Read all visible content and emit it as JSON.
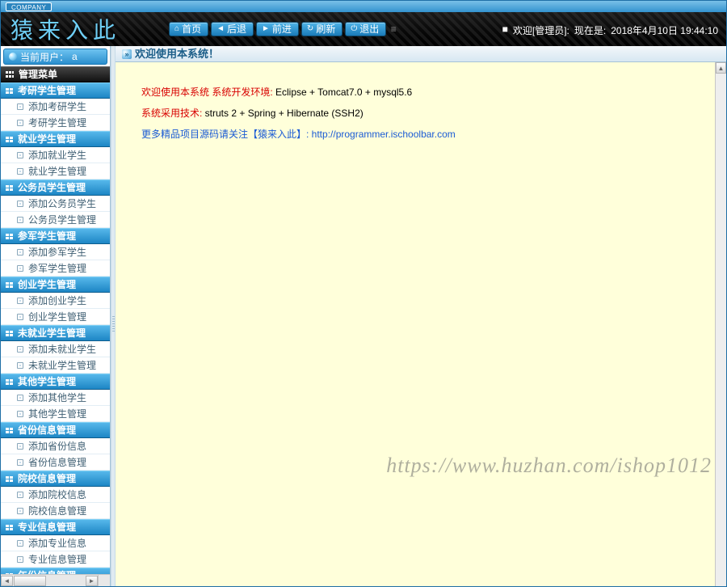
{
  "company_badge": "COMPANY",
  "logo": "猿来入此",
  "toolbar": {
    "home": "首页",
    "back": "后退",
    "forward": "前进",
    "refresh": "刷新",
    "logout": "退出"
  },
  "header_right": {
    "welcome": "欢迎[管理员]:",
    "now_label": "现在是:",
    "datetime": "2018年4月10日 19:44:10"
  },
  "sidebar": {
    "current_user_label": "当前用户：",
    "current_user_value": "a",
    "menu_header": "管理菜单",
    "groups": [
      {
        "title": "考研学生管理",
        "items": [
          "添加考研学生",
          "考研学生管理"
        ]
      },
      {
        "title": "就业学生管理",
        "items": [
          "添加就业学生",
          "就业学生管理"
        ]
      },
      {
        "title": "公务员学生管理",
        "items": [
          "添加公务员学生",
          "公务员学生管理"
        ]
      },
      {
        "title": "参军学生管理",
        "items": [
          "添加参军学生",
          "参军学生管理"
        ]
      },
      {
        "title": "创业学生管理",
        "items": [
          "添加创业学生",
          "创业学生管理"
        ]
      },
      {
        "title": "未就业学生管理",
        "items": [
          "添加未就业学生",
          "未就业学生管理"
        ]
      },
      {
        "title": "其他学生管理",
        "items": [
          "添加其他学生",
          "其他学生管理"
        ]
      },
      {
        "title": "省份信息管理",
        "items": [
          "添加省份信息",
          "省份信息管理"
        ]
      },
      {
        "title": "院校信息管理",
        "items": [
          "添加院校信息",
          "院校信息管理"
        ]
      },
      {
        "title": "专业信息管理",
        "items": [
          "添加专业信息",
          "专业信息管理"
        ]
      },
      {
        "title": "年份信息管理",
        "items": []
      }
    ]
  },
  "main": {
    "title": "欢迎使用本系统！",
    "line1_red": "欢迎使用本系统 系统开发环境: ",
    "line1_black": "Eclipse + Tomcat7.0 + mysql5.6",
    "line2_red": "系统采用技术: ",
    "line2_black": "struts 2 + Spring + Hibernate (SSH2)",
    "line3_blue": "更多精品项目源码请关注【猿来入此】: ",
    "line3_link": "http://programmer.ischoolbar.com"
  },
  "watermark": "https://www.huzhan.com/ishop1012"
}
